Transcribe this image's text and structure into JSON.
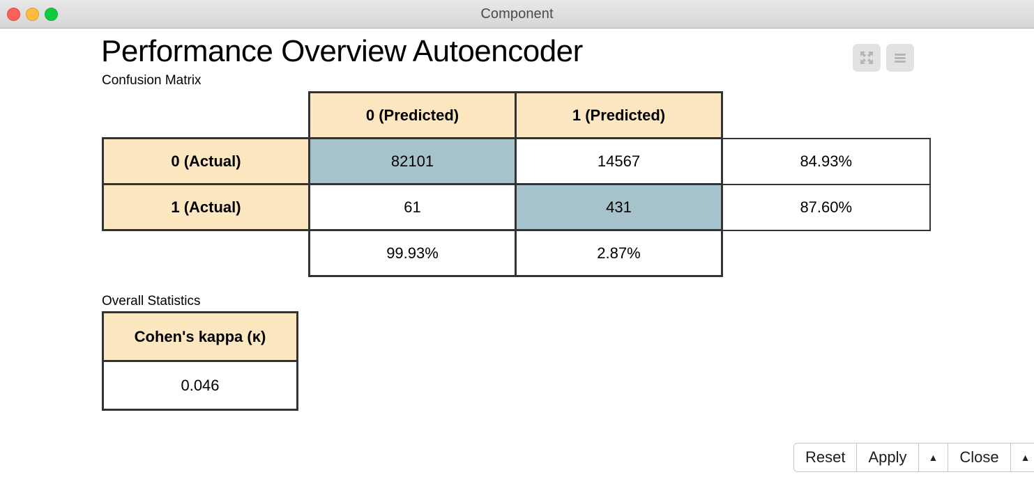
{
  "window": {
    "title": "Component",
    "traffic_lights": [
      {
        "name": "close-button",
        "color": "#fc6058"
      },
      {
        "name": "minimize-button",
        "color": "#fdbc40"
      },
      {
        "name": "maximize-button",
        "color": "#10cb3f"
      }
    ]
  },
  "header": {
    "page_title": "Performance Overview Autoencoder",
    "icons": [
      {
        "name": "expand-icon"
      },
      {
        "name": "menu-icon"
      }
    ]
  },
  "sections": {
    "confusion_matrix_label": "Confusion Matrix",
    "overall_statistics_label": "Overall Statistics"
  },
  "chart_data": {
    "type": "table",
    "title": "Confusion Matrix",
    "column_headers": [
      "0 (Predicted)",
      "1 (Predicted)"
    ],
    "row_headers": [
      "0 (Actual)",
      "1 (Actual)"
    ],
    "corner": "",
    "matrix": [
      [
        82101,
        14567
      ],
      [
        61,
        431
      ]
    ],
    "row_percentages": [
      "84.93%",
      "87.60%"
    ],
    "column_percentages": [
      "99.93%",
      "2.87%"
    ],
    "diagonal_highlight_color": "#a6c3cb",
    "header_color": "#fce7c0",
    "cells": {
      "r0c0": "82101",
      "r0c1": "14567",
      "r1c0": "61",
      "r1c1": "431",
      "r0pct": "84.93%",
      "r1pct": "87.60%",
      "c0pct": "99.93%",
      "c1pct": "2.87%"
    }
  },
  "overall_statistics": {
    "header": "Cohen's kappa (κ)",
    "value": "0.046"
  },
  "footer": {
    "buttons": [
      {
        "name": "reset-button",
        "label": "Reset"
      },
      {
        "name": "apply-button",
        "label": "Apply"
      },
      {
        "name": "apply-menu-button",
        "label": "▲"
      },
      {
        "name": "close-button",
        "label": "Close"
      },
      {
        "name": "close-menu-button",
        "label": "▲"
      }
    ]
  }
}
